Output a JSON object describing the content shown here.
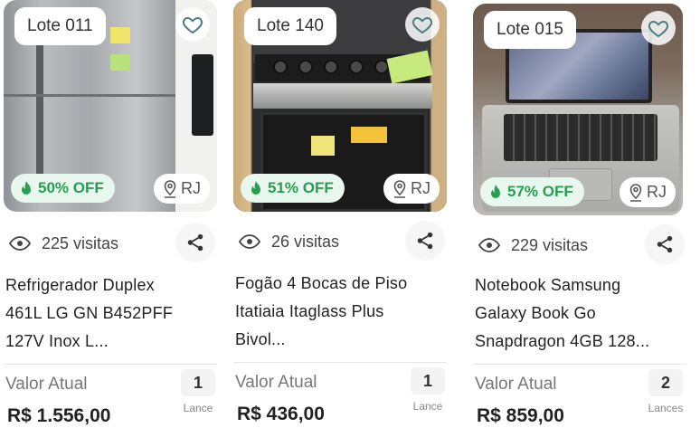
{
  "cards": [
    {
      "lot": "Lote 011",
      "discount": "50% OFF",
      "location": "RJ",
      "visits": "225 visitas",
      "title_lines": [
        "Refrigerador Duplex",
        "461L LG GN B452PFF",
        "127V Inox L..."
      ],
      "price_label": "Valor Atual",
      "price": "R$ 1.556,00",
      "bids": "1",
      "bids_label": "Lance"
    },
    {
      "lot": "Lote 140",
      "discount": "51% OFF",
      "location": "RJ",
      "visits": "26 visitas",
      "title_lines": [
        "Fogão 4 Bocas de Piso",
        "Itatiaia Itaglass Plus",
        "Bivol..."
      ],
      "price_label": "Valor Atual",
      "price": "R$ 436,00",
      "bids": "1",
      "bids_label": "Lance"
    },
    {
      "lot": "Lote 015",
      "discount": "57% OFF",
      "location": "RJ",
      "visits": "229 visitas",
      "title_lines": [
        "Notebook Samsung",
        "Galaxy Book Go",
        "Snapdragon 4GB 128..."
      ],
      "price_label": "Valor Atual",
      "price": "R$ 859,00",
      "bids": "2",
      "bids_label": "Lances"
    }
  ],
  "colors": {
    "discount_text": "#2a9d52",
    "discount_bg": "#e9f8ee",
    "heart_stroke": "#4a7d84"
  },
  "icons": [
    "heart-icon",
    "fire-icon",
    "location-pin-icon",
    "eye-icon",
    "share-icon"
  ]
}
